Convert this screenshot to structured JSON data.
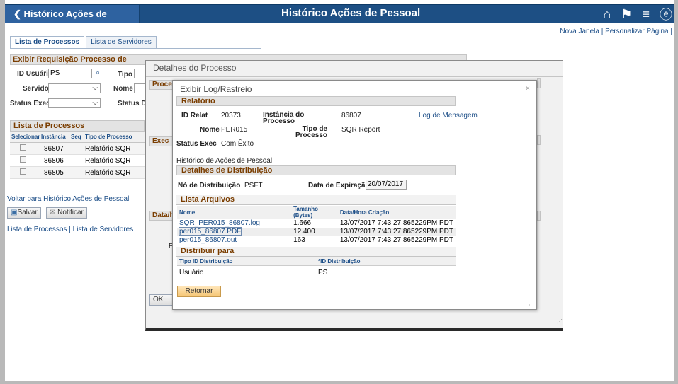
{
  "topbar": {
    "back_label": "Histórico Ações de Pessoal",
    "title": "Histórico Ações de Pessoal"
  },
  "toplinks": "Nova Janela | Personalizar Página |",
  "tabs": [
    {
      "label": "Lista de Processos"
    },
    {
      "label": "Lista de Servidores"
    }
  ],
  "section_title": "Exibir Requisição Processo de",
  "fields": {
    "id_usuario_label": "ID Usuário",
    "id_usuario_value": "PS",
    "tipo_label": "Tipo",
    "servidor_label": "Servidor",
    "nome_label": "Nome",
    "status_exec_label": "Status Exec",
    "status_di_label": "Status Di"
  },
  "lista_processos": {
    "title": "Lista de Processos",
    "columns": [
      "Selecionar",
      "Instância",
      "Seq",
      "Tipo de Processo"
    ],
    "rows": [
      {
        "instancia": "86807",
        "tipo": "Relatório SQR"
      },
      {
        "instancia": "86806",
        "tipo": "Relatório SQR"
      },
      {
        "instancia": "86805",
        "tipo": "Relatório SQR"
      }
    ]
  },
  "links": {
    "voltar": "Voltar para Histórico Ações de Pessoal",
    "salvar": "Salvar",
    "notificar": "Notificar",
    "bottom": "Lista de Processos | Lista de Servidores"
  },
  "modal_detalhes": {
    "title": "Detalhes do Processo",
    "frag_proce": "Proce",
    "frag_exec": "Exec",
    "frag_datah": "Data/h",
    "frag_e": "E",
    "ok_label": "OK"
  },
  "modal_log": {
    "title": "Exibir Log/Rastreio",
    "close": "×",
    "relatorio": {
      "title": "Relatório",
      "id_relat_label": "ID Relat",
      "id_relat_value": "20373",
      "instancia_label": "Instância do Processo",
      "instancia_value": "86807",
      "log_link": "Log de Mensagem",
      "nome_label": "Nome",
      "nome_value": "PER015",
      "tipo_label": "Tipo de Processo",
      "tipo_value": "SQR Report",
      "status_label": "Status Exec",
      "status_value": "Com Êxito",
      "descricao": "Histórico de Ações de Pessoal"
    },
    "distribuicao": {
      "title": "Detalhes de Distribuição",
      "no_label": "Nó de Distribuição",
      "no_value": "PSFT",
      "exp_label": "Data de Expiração",
      "exp_value": "20/07/2017"
    },
    "arquivos": {
      "title": "Lista Arquivos",
      "columns": [
        "Nome",
        "Tamanho (Bytes)",
        "Data/Hora Criação"
      ],
      "rows": [
        {
          "nome": "SQR_PER015_86807.log",
          "tamanho": "1.666",
          "data": "13/07/2017  7:43:27,865229PM PDT"
        },
        {
          "nome": "per015_86807.PDF",
          "tamanho": "12.400",
          "data": "13/07/2017  7:43:27,865229PM PDT"
        },
        {
          "nome": "per015_86807.out",
          "tamanho": "163",
          "data": "13/07/2017  7:43:27,865229PM PDT"
        }
      ]
    },
    "distribuir": {
      "title": "Distribuir para",
      "columns": [
        "Tipo ID Distribuição",
        "*ID Distribuição"
      ],
      "tipo_value": "Usuário",
      "id_value": "PS"
    },
    "retornar": "Retornar"
  }
}
